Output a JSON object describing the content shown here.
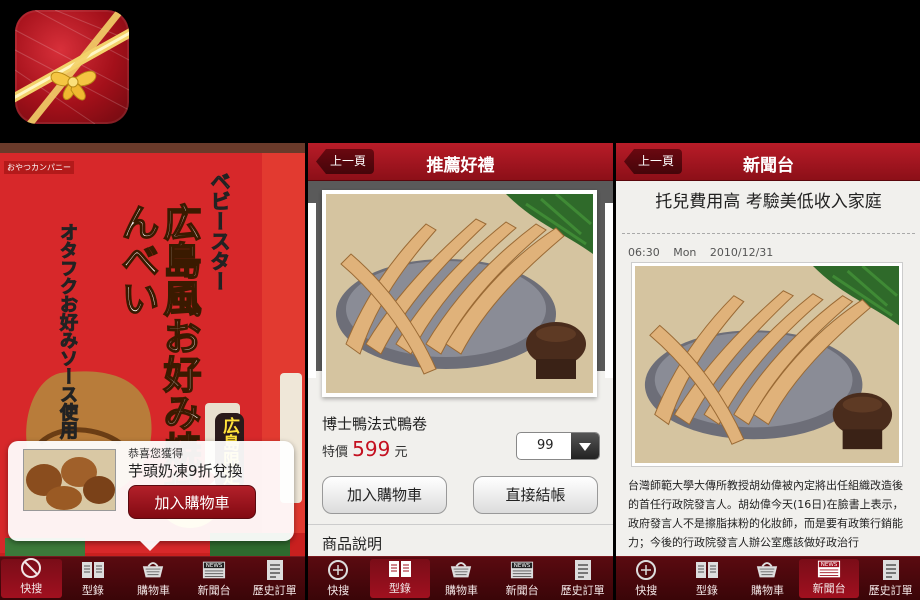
{
  "screen1": {
    "popup": {
      "line1": "恭喜您獲得",
      "line2": "芋頭奶凍9折兌換",
      "button": "加入購物車"
    },
    "photo_text": {
      "brand_small": "おやつカンパニー",
      "title_main": "広島風お好み焼せんべい",
      "title_brand": "ベビースター",
      "badge": "広島限定",
      "side_label": "オタフクお好みソース使用"
    }
  },
  "screen2": {
    "back": "上一頁",
    "title": "推薦好禮",
    "product_name": "博士鴨法式鴨卷",
    "price_prefix": "特價",
    "price_value": "599",
    "price_unit": "元",
    "quantity": "99",
    "add_to_cart": "加入購物車",
    "checkout": "直接結帳",
    "section_title": "商品說明"
  },
  "screen3": {
    "back": "上一頁",
    "title": "新聞台",
    "headline": "托兒費用高 考驗美低收入家庭",
    "time": "06:30",
    "weekday": "Mon",
    "date": "2010/12/31",
    "body": "台灣師範大學大傳所教授胡幼偉被內定將出任組織改造後的首任行政院發言人。胡幼偉今天(16日)在臉書上表示，政府發言人不是擦脂抹粉的化妝師，而是要有政策行銷能力；今後的行政院發言人辦公室應該做好政治行"
  },
  "tabs": [
    {
      "label": "快搜",
      "icon": "scan-icon"
    },
    {
      "label": "型錄",
      "icon": "catalog-icon"
    },
    {
      "label": "購物車",
      "icon": "cart-icon"
    },
    {
      "label": "新聞台",
      "icon": "news-icon",
      "badge": "NEWS"
    },
    {
      "label": "歷史訂單",
      "icon": "orders-icon"
    }
  ],
  "active_tab": {
    "screen1": 0,
    "screen2": 1,
    "screen3": 3
  },
  "colors": {
    "brand_red": "#a3101a",
    "price_red": "#c41020",
    "tabbar": "#3a0508"
  }
}
